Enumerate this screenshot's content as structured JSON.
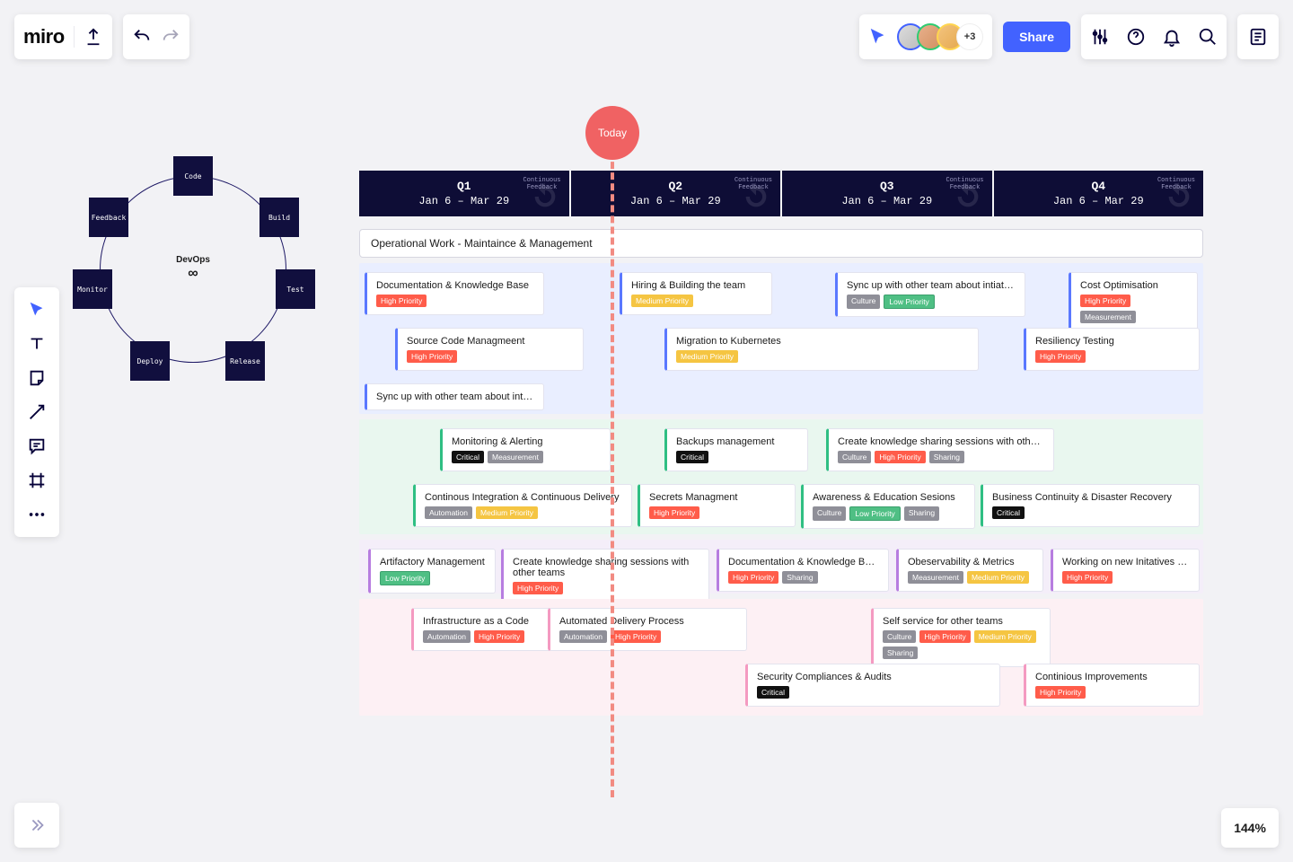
{
  "app": {
    "logo": "miro"
  },
  "header": {
    "share_label": "Share",
    "avatar_more": "+3"
  },
  "zoom": "144%",
  "today_label": "Today",
  "continuous_feedback": "Continuous Feedback",
  "devops": {
    "center_label": "DevOps",
    "infinity": "∞",
    "nodes": [
      "Code",
      "Build",
      "Test",
      "Release",
      "Deploy",
      "Monitor",
      "Feedback"
    ]
  },
  "quarters": [
    {
      "name": "Q1",
      "dates": "Jan 6 – Mar 29"
    },
    {
      "name": "Q2",
      "dates": "Jan 6 – Mar 29"
    },
    {
      "name": "Q3",
      "dates": "Jan 6 – Mar 29"
    },
    {
      "name": "Q4",
      "dates": "Jan 6 – Mar 29"
    }
  ],
  "operational_row": "Operational Work - Maintaince & Management",
  "tags": {
    "high": "High Priority",
    "medium": "Medium Priority",
    "low": "Low Priority",
    "critical": "Critical",
    "measurement": "Measurement",
    "culture": "Culture",
    "automation": "Automation",
    "sharing": "Sharing"
  },
  "lanes": {
    "blue": {
      "r1": [
        {
          "title": "Documentation & Knowledge Base",
          "tags": [
            "high"
          ]
        },
        {
          "title": "Hiring & Building the team",
          "tags": [
            "medium"
          ]
        },
        {
          "title": "Sync up with other team about intiatives",
          "tags": [
            "culture",
            "low"
          ]
        },
        {
          "title": "Cost Optimisation",
          "tags": [
            "high",
            "measurement"
          ]
        }
      ],
      "r2": [
        {
          "title": "Source Code Managmeent",
          "tags": [
            "high"
          ]
        },
        {
          "title": "Migration to Kubernetes",
          "tags": [
            "medium"
          ]
        },
        {
          "title": "Resiliency Testing",
          "tags": [
            "high"
          ]
        }
      ],
      "r3": [
        {
          "title": "Sync up with other team about intiatives",
          "tags": []
        }
      ]
    },
    "green": {
      "r1": [
        {
          "title": "Monitoring & Alerting",
          "tags": [
            "critical",
            "measurement"
          ]
        },
        {
          "title": "Backups management",
          "tags": [
            "critical"
          ]
        },
        {
          "title": "Create knowledge sharing sessions with other teams",
          "tags": [
            "culture",
            "high",
            "sharing"
          ]
        }
      ],
      "r2": [
        {
          "title": "Continous Integration & Continuous Delivery",
          "tags": [
            "automation",
            "medium"
          ]
        },
        {
          "title": "Secrets Managment",
          "tags": [
            "high"
          ]
        },
        {
          "title": "Awareness & Education Sesions",
          "tags": [
            "culture",
            "low",
            "sharing"
          ]
        },
        {
          "title": "Business Continuity & Disaster Recovery",
          "tags": [
            "critical"
          ]
        }
      ]
    },
    "purple": {
      "r1": [
        {
          "title": "Artifactory Management",
          "tags": [
            "low"
          ]
        },
        {
          "title": "Create knowledge sharing sessions with other teams",
          "tags": [
            "high"
          ]
        },
        {
          "title": "Documentation & Knowledge Base",
          "tags": [
            "high",
            "sharing"
          ]
        },
        {
          "title": "Obeservability & Metrics",
          "tags": [
            "measurement",
            "medium"
          ]
        },
        {
          "title": "Working on new Initatives & Ideas",
          "tags": [
            "high"
          ]
        }
      ]
    },
    "pink": {
      "r1": [
        {
          "title": "Infrastructure as a Code",
          "tags": [
            "automation",
            "high"
          ]
        },
        {
          "title": "Automated Delivery Process",
          "tags": [
            "automation",
            "high"
          ]
        },
        {
          "title": "Self service for other teams",
          "tags": [
            "culture",
            "high",
            "medium",
            "sharing"
          ]
        }
      ],
      "r2": [
        {
          "title": "Security Compliances & Audits",
          "tags": [
            "critical"
          ]
        },
        {
          "title": "Continious Improvements",
          "tags": [
            "high"
          ]
        }
      ]
    }
  }
}
